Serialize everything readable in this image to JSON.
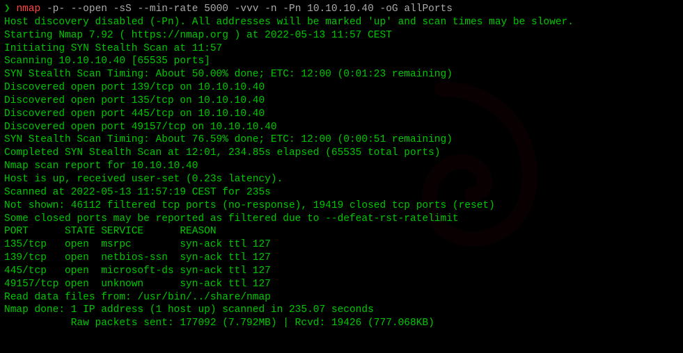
{
  "prompt_char": "❯",
  "command": {
    "name": "nmap",
    "args": "-p- --open -sS --min-rate 5000 -vvv -n -Pn 10.10.10.40 -oG allPorts"
  },
  "lines": [
    "Host discovery disabled (-Pn). All addresses will be marked 'up' and scan times may be slower.",
    "Starting Nmap 7.92 ( https://nmap.org ) at 2022-05-13 11:57 CEST",
    "Initiating SYN Stealth Scan at 11:57",
    "Scanning 10.10.10.40 [65535 ports]",
    "SYN Stealth Scan Timing: About 50.00% done; ETC: 12:00 (0:01:23 remaining)",
    "Discovered open port 139/tcp on 10.10.10.40",
    "Discovered open port 135/tcp on 10.10.10.40",
    "Discovered open port 445/tcp on 10.10.10.40",
    "Discovered open port 49157/tcp on 10.10.10.40",
    "SYN Stealth Scan Timing: About 76.59% done; ETC: 12:00 (0:00:51 remaining)",
    "Completed SYN Stealth Scan at 12:01, 234.85s elapsed (65535 total ports)",
    "Nmap scan report for 10.10.10.40",
    "Host is up, received user-set (0.23s latency).",
    "Scanned at 2022-05-13 11:57:19 CEST for 235s",
    "Not shown: 46112 filtered tcp ports (no-response), 19419 closed tcp ports (reset)",
    "Some closed ports may be reported as filtered due to --defeat-rst-ratelimit",
    "PORT      STATE SERVICE      REASON",
    "135/tcp   open  msrpc        syn-ack ttl 127",
    "139/tcp   open  netbios-ssn  syn-ack ttl 127",
    "445/tcp   open  microsoft-ds syn-ack ttl 127",
    "49157/tcp open  unknown      syn-ack ttl 127",
    "",
    "Read data files from: /usr/bin/../share/nmap",
    "Nmap done: 1 IP address (1 host up) scanned in 235.07 seconds",
    "           Raw packets sent: 177092 (7.792MB) | Rcvd: 19426 (777.068KB)"
  ]
}
